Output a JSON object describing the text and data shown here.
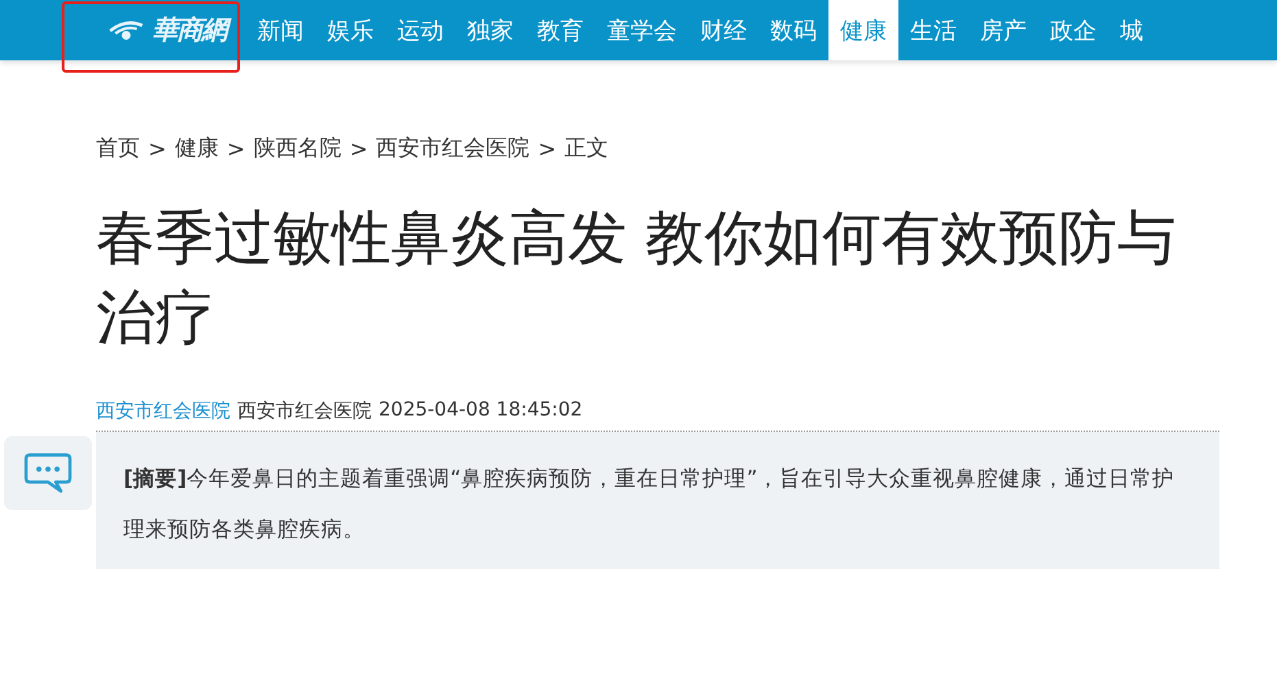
{
  "header": {
    "logo_text": "華商網",
    "highlighted": true,
    "nav": [
      {
        "label": "新闻",
        "selected": false
      },
      {
        "label": "娱乐",
        "selected": false
      },
      {
        "label": "运动",
        "selected": false
      },
      {
        "label": "独家",
        "selected": false
      },
      {
        "label": "教育",
        "selected": false
      },
      {
        "label": "童学会",
        "selected": false
      },
      {
        "label": "财经",
        "selected": false
      },
      {
        "label": "数码",
        "selected": false
      },
      {
        "label": "健康",
        "selected": true
      },
      {
        "label": "生活",
        "selected": false
      },
      {
        "label": "房产",
        "selected": false
      },
      {
        "label": "政企",
        "selected": false
      },
      {
        "label": "城",
        "selected": false
      }
    ]
  },
  "breadcrumb": {
    "separator": ">",
    "items": [
      "首页",
      "健康",
      "陕西名院",
      "西安市红会医院",
      "正文"
    ]
  },
  "article": {
    "title": "春季过敏性鼻炎高发 教你如何有效预防与治疗",
    "source_link": "西安市红会医院",
    "author": "西安市红会医院",
    "date": "2025-04-08 18:45:02",
    "summary": "**[摘要]**今年爱鼻日的主题着重强调“鼻腔疾病预防，重在日常护理”，旨在引导大众重视鼻腔健康，通过日常护理来预防各类鼻腔疾病。"
  }
}
